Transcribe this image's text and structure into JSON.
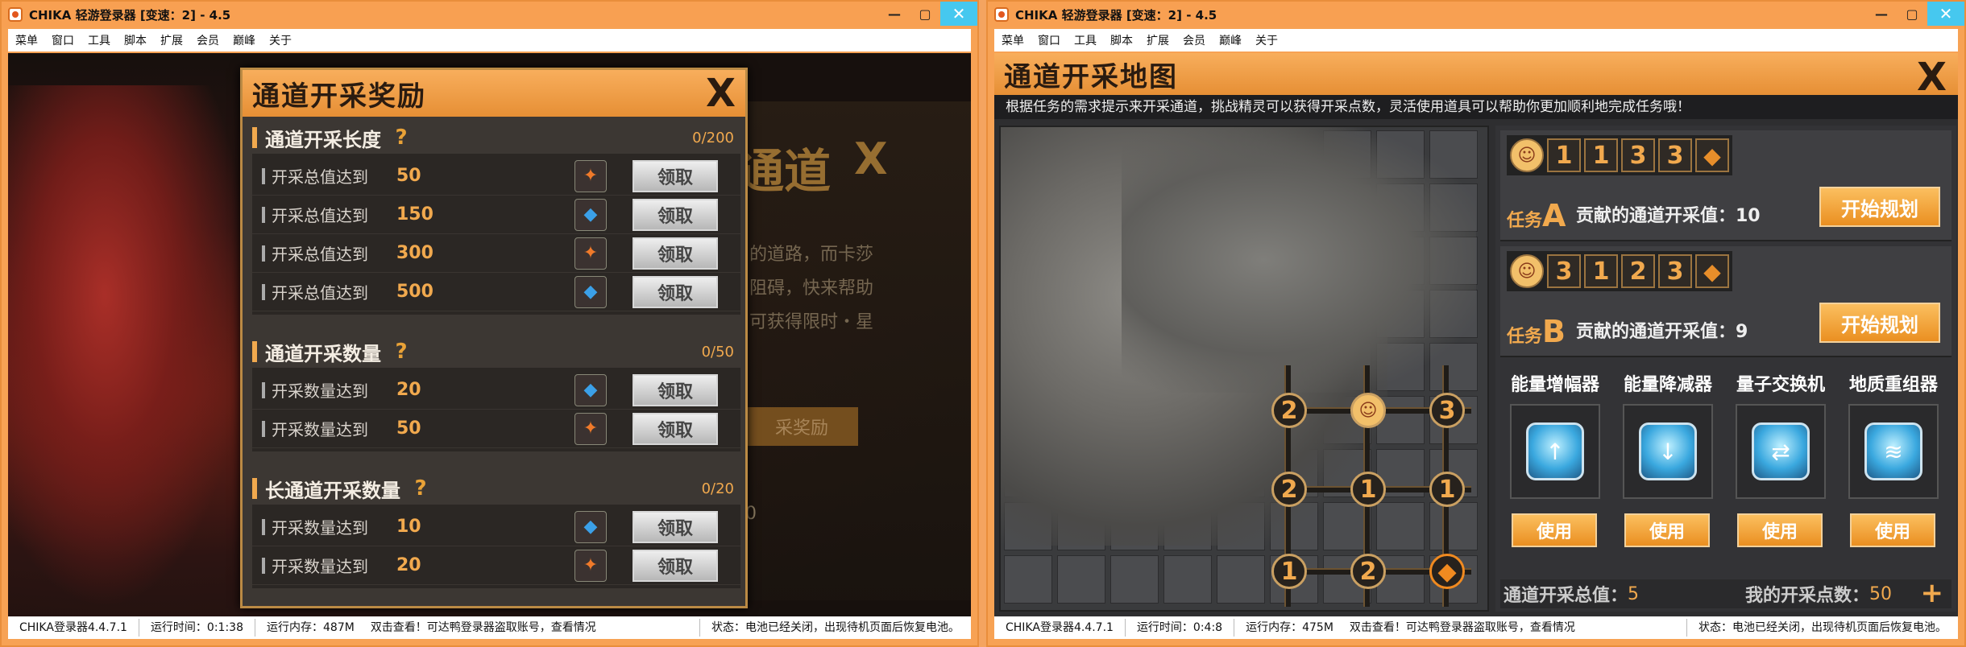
{
  "left": {
    "title": "CHIKA 轻游登录器 [变速：2] - 4.5",
    "menu": [
      "菜单",
      "窗口",
      "工具",
      "脚本",
      "扩展",
      "会员",
      "巅峰",
      "关于"
    ],
    "background": {
      "title": "通道",
      "close": "X",
      "lines": [
        "的道路，而卡莎",
        "阻碍，快来帮助",
        "可获得限时・星"
      ],
      "button": "采奖励",
      "digit": "0"
    },
    "dialog": {
      "title": "通道开采奖励",
      "close": "X",
      "sections": [
        {
          "name": "通道开采长度",
          "count": "0/200",
          "rows": [
            {
              "label": "开采总值达到",
              "value": "50",
              "reward": "orange",
              "btn": "领取"
            },
            {
              "label": "开采总值达到",
              "value": "150",
              "reward": "blue",
              "btn": "领取"
            },
            {
              "label": "开采总值达到",
              "value": "300",
              "reward": "orange",
              "btn": "领取"
            },
            {
              "label": "开采总值达到",
              "value": "500",
              "reward": "blue",
              "btn": "领取"
            }
          ]
        },
        {
          "name": "通道开采数量",
          "count": "0/50",
          "rows": [
            {
              "label": "开采数量达到",
              "value": "20",
              "reward": "blue",
              "btn": "领取"
            },
            {
              "label": "开采数量达到",
              "value": "50",
              "reward": "orange",
              "btn": "领取"
            }
          ]
        },
        {
          "name": "长通道开采数量",
          "count": "0/20",
          "rows": [
            {
              "label": "开采数量达到",
              "value": "10",
              "reward": "blue",
              "btn": "领取"
            },
            {
              "label": "开采数量达到",
              "value": "20",
              "reward": "orange",
              "btn": "领取"
            }
          ]
        }
      ]
    },
    "status": {
      "version": "CHIKA登录器4.4.7.1",
      "runtime": "运行时间：0:1:38",
      "memory": "运行内存：487M",
      "notice": "双击查看！可达鸭登录器盗取账号，查看情况",
      "state": "状态：电池已经关闭，出现待机页面后恢复电池。"
    }
  },
  "right": {
    "title": "CHIKA 轻游登录器 [变速：2] - 4.5",
    "menu": [
      "菜单",
      "窗口",
      "工具",
      "脚本",
      "扩展",
      "会员",
      "巅峰",
      "关于"
    ],
    "map": {
      "title": "通道开采地图",
      "close": "X",
      "desc": "根据任务的需求提示来开采通道，挑战精灵可以获得开采点数，灵活使用道具可以帮助你更加顺利地完成任务哦！",
      "nodes": [
        "2",
        "3",
        "2",
        "1",
        "1",
        "1",
        "2"
      ],
      "tasks": [
        {
          "prefix": "任务",
          "letter": "A",
          "desc": "贡献的通道开采值：10",
          "seq": [
            "1",
            "1",
            "3",
            "3"
          ],
          "btn": "开始规划"
        },
        {
          "prefix": "任务",
          "letter": "B",
          "desc": "贡献的通道开采值：9",
          "seq": [
            "3",
            "1",
            "2",
            "3"
          ],
          "btn": "开始规划"
        }
      ],
      "tools": [
        {
          "name": "能量增幅器",
          "btn": "使用"
        },
        {
          "name": "能量降减器",
          "btn": "使用"
        },
        {
          "name": "量子交换机",
          "btn": "使用"
        },
        {
          "name": "地质重组器",
          "btn": "使用"
        }
      ],
      "total_label": "通道开采总值：",
      "total_value": "5",
      "points_label": "我的开采点数：",
      "points_value": "50"
    },
    "status": {
      "version": "CHIKA登录器4.4.7.1",
      "runtime": "运行时间：0:4:8",
      "memory": "运行内存：475M",
      "notice": "双击查看！可达鸭登录器盗取账号，查看情况",
      "state": "状态：电池已经关闭，出现待机页面后恢复电池。"
    }
  },
  "icons": {
    "minimize": "minimize-icon",
    "maximize": "maximize-icon",
    "close": "close-icon",
    "help": "question-icon",
    "plus": "plus-icon"
  },
  "colors": {
    "accent": "#f1a94e",
    "titlebar": "#f8a052",
    "close_btn": "#46c8ef"
  }
}
